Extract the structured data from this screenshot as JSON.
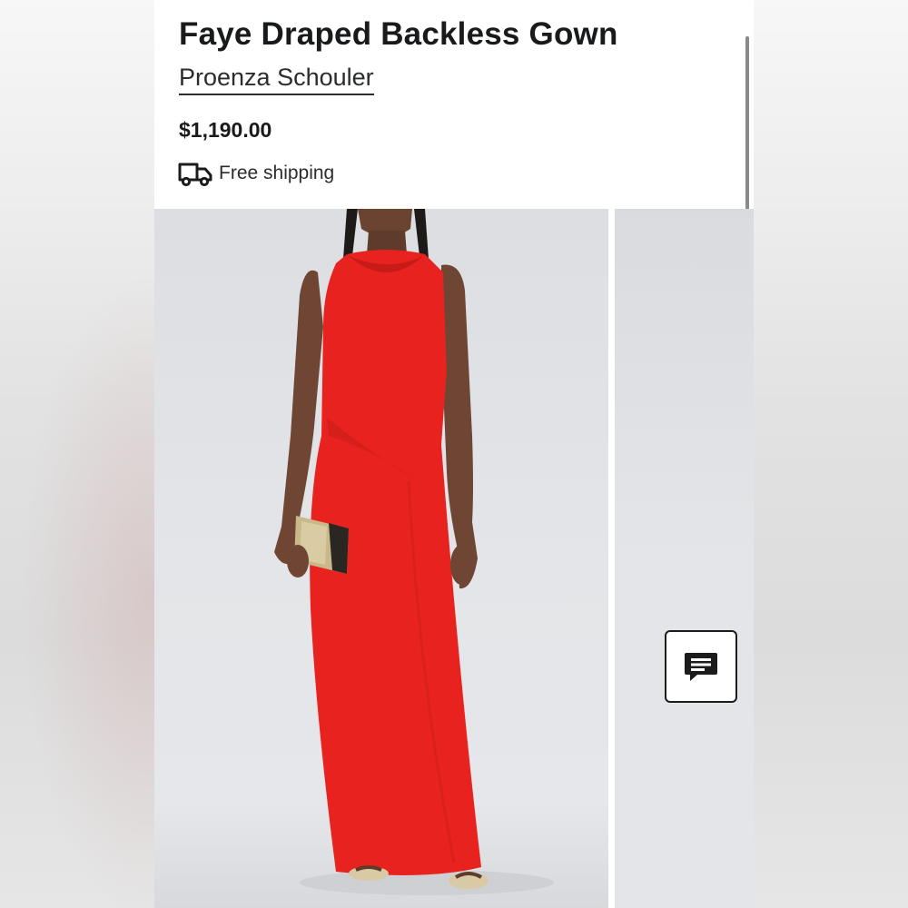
{
  "product": {
    "title": "Faye Draped Backless Gown",
    "brand": "Proenza Schouler",
    "price": "$1,190.00",
    "shipping_label": "Free shipping",
    "shipping_icon": "truck-icon"
  },
  "gallery": {
    "image_count_visible": 2,
    "dress_color": "#e8231f"
  },
  "chat": {
    "icon": "chat-bubble-icon"
  },
  "colors": {
    "text_primary": "#191a1b",
    "background": "#ffffff"
  }
}
